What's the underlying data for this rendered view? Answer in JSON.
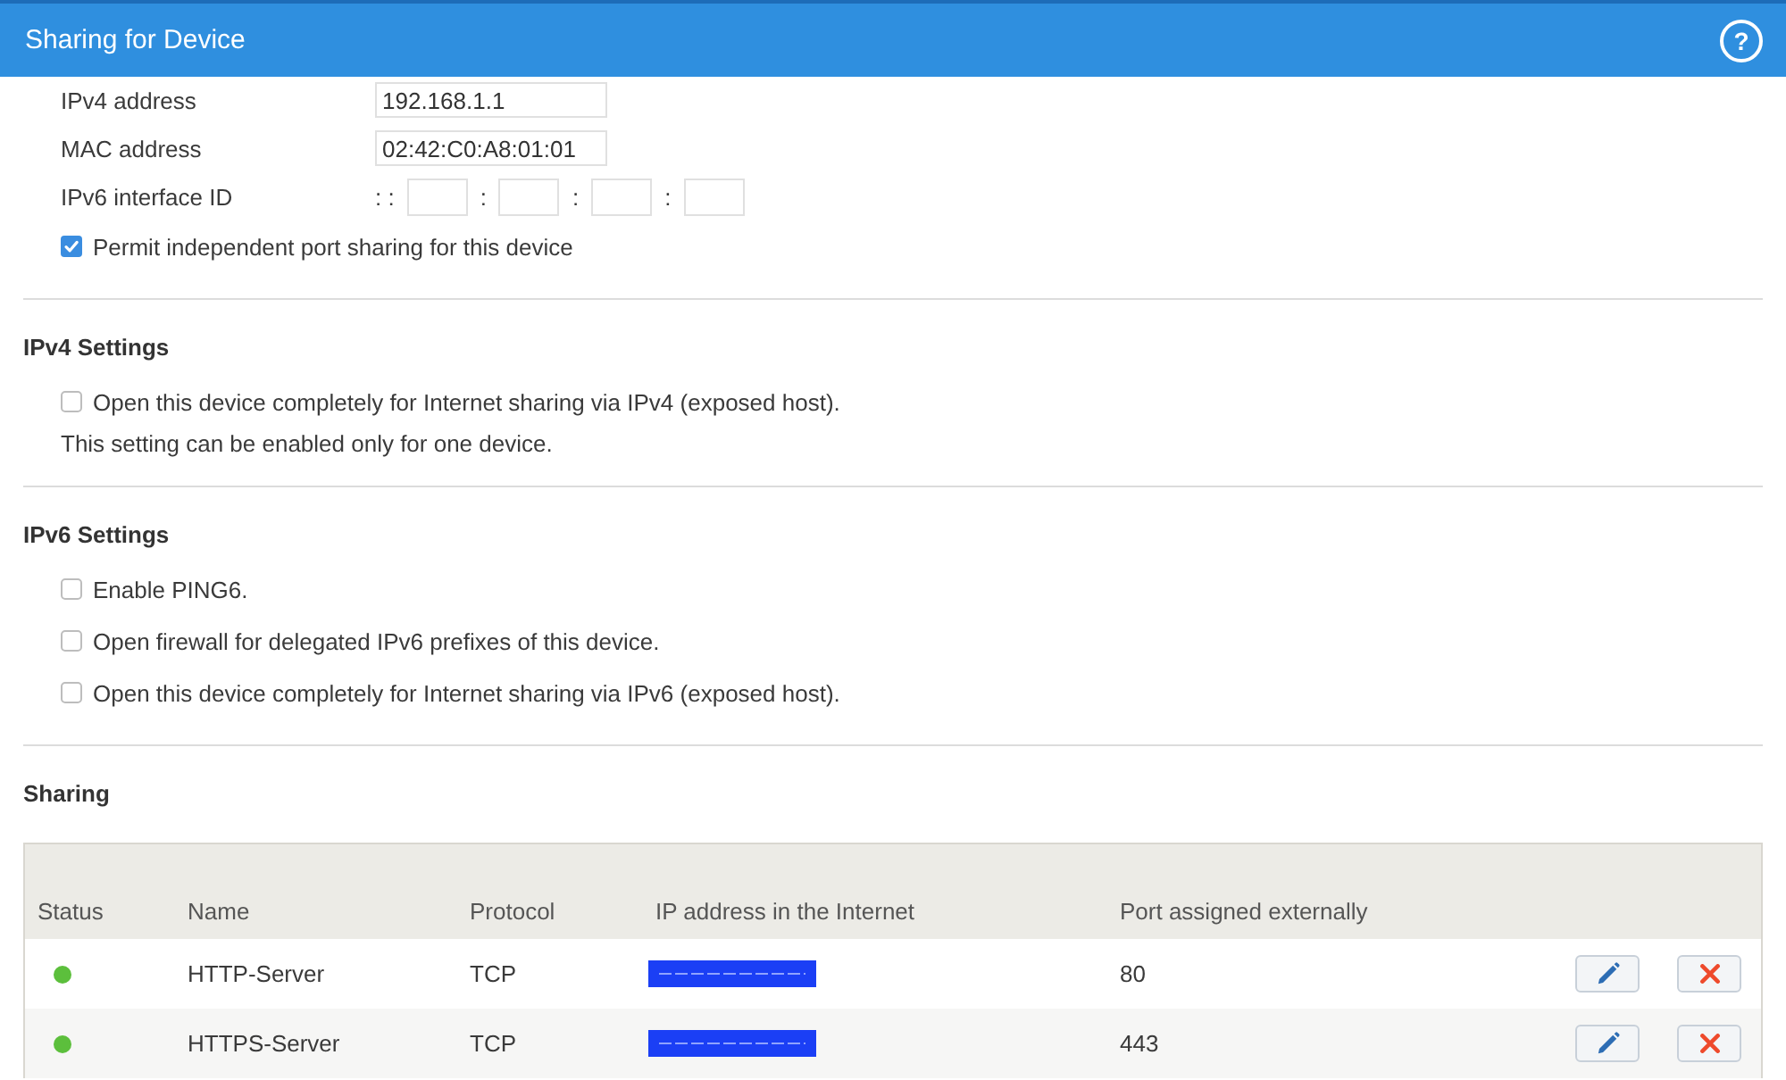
{
  "header": {
    "title": "Sharing for Device",
    "help": "?"
  },
  "device": {
    "fields": [
      {
        "kind": "text",
        "label": "IPv4 address",
        "value": "192.168.1.1"
      },
      {
        "kind": "text",
        "label": "MAC address",
        "value": "02:42:C0:A8:01:01"
      },
      {
        "kind": "ipv6",
        "label": "IPv6 interface ID",
        "groups": [
          {
            "lead": ": :"
          },
          {
            "lead": ":"
          },
          {
            "lead": ":"
          },
          {
            "lead": ":"
          }
        ]
      }
    ],
    "options": [
      {
        "label": "Permit independent port sharing for this device",
        "checked": true
      }
    ]
  },
  "sections": [
    {
      "title": "IPv4 Settings",
      "options": [
        {
          "label": "Open this device completely for Internet sharing via IPv4 (exposed host).",
          "checked": false
        }
      ],
      "note": "This setting can be enabled only for one device."
    },
    {
      "title": "IPv6 Settings",
      "options": [
        {
          "label": "Enable PING6.",
          "checked": false
        },
        {
          "label": "Open firewall for delegated IPv6 prefixes of this device.",
          "checked": false
        },
        {
          "label": "Open this device completely for Internet sharing via IPv6 (exposed host).",
          "checked": false
        }
      ]
    }
  ],
  "sharing": {
    "title": "Sharing",
    "table": {
      "columns": [
        "Status",
        "Name",
        "Protocol",
        "IP address in the Internet",
        "Port assigned externally"
      ],
      "rows": [
        {
          "color": "#5cbf3c",
          "name": "HTTP-Server",
          "protocol": "TCP",
          "ip_redacted": true,
          "port": "80"
        },
        {
          "color": "#5cbf3c",
          "name": "HTTPS-Server",
          "protocol": "TCP",
          "ip_redacted": true,
          "port": "443"
        }
      ]
    }
  }
}
